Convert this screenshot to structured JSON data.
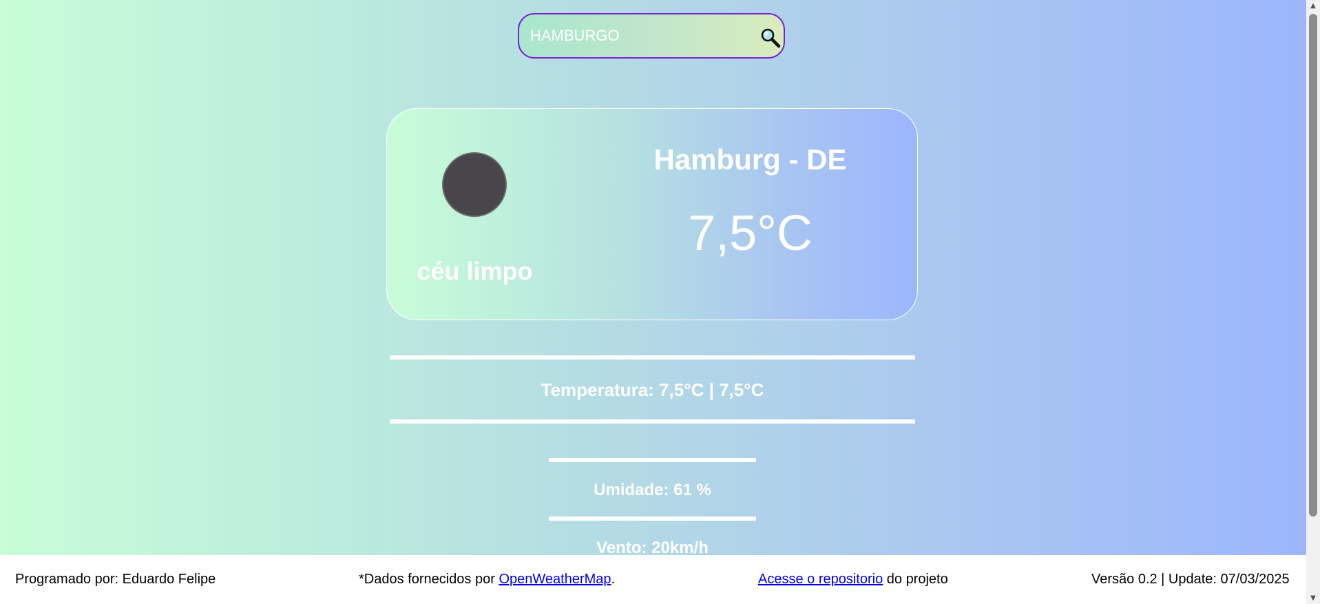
{
  "search": {
    "value": "HAMBURGO",
    "icon": "search-icon"
  },
  "weather": {
    "city": "Hamburg - DE",
    "temperature": "7,5°C",
    "description": "céu limpo",
    "icon": "weather-icon"
  },
  "details": {
    "temperature": "Temperatura: 7,5°C | 7,5°C",
    "humidity": "Umidade: 61 %",
    "wind": "Vento: 20km/h"
  },
  "footer": {
    "author": "Programado por: Eduardo Felipe",
    "data_prefix": "*Dados fornecidos por ",
    "data_link": "OpenWeatherMap",
    "data_suffix": ".",
    "repo_link": "Acesse o repositorio",
    "repo_suffix": " do projeto",
    "version": "Versão 0.2 | Update: 07/03/2025"
  },
  "colors": {
    "gradient_start": "#c8fdd8",
    "gradient_end": "#9cb6fd",
    "search_border": "#7b22d6",
    "text": "#ffffff",
    "link": "#0000ee"
  }
}
